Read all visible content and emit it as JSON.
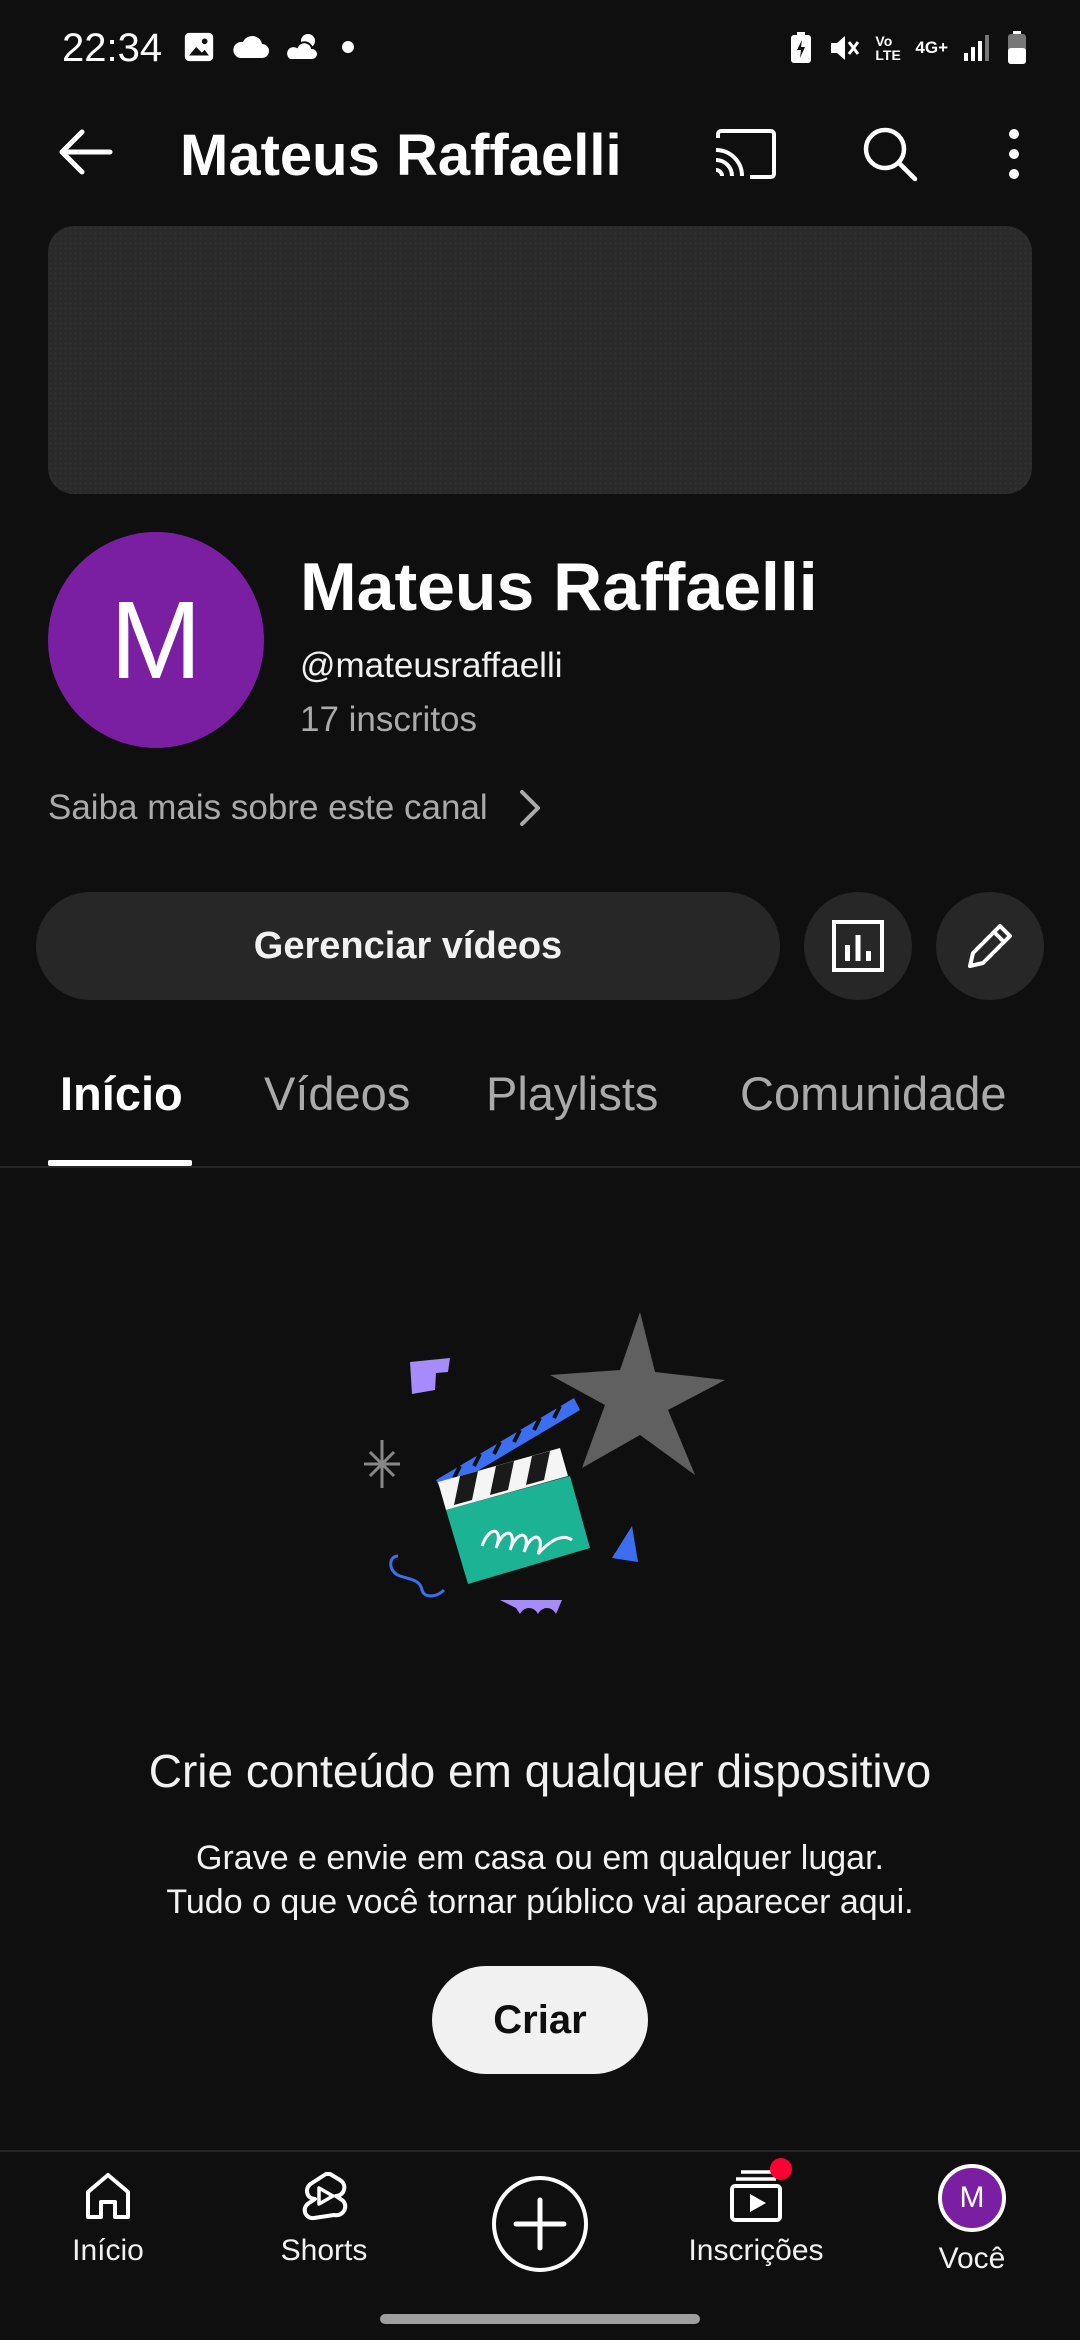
{
  "status_bar": {
    "time": "22:34",
    "left_icons": [
      "gallery-icon",
      "cloud-icon",
      "weather-icon",
      "dot-icon"
    ],
    "right_icons": [
      "battery-saver-icon",
      "mute-icon",
      "volte-icon",
      "network-4g-icon",
      "signal-icon",
      "battery-icon"
    ],
    "volte_label": "Vo LTE",
    "network_label": "4G+"
  },
  "app_bar": {
    "title": "Mateus Raffaelli",
    "icons": [
      "back-arrow-icon",
      "cast-icon",
      "search-icon",
      "more-vert-icon"
    ]
  },
  "channel": {
    "avatar_letter": "M",
    "avatar_color": "#7b1fa2",
    "name": "Mateus Raffaelli",
    "handle": "@mateusraffaelli",
    "subscribers": "17 inscritos",
    "more_info": "Saiba mais sobre este canal"
  },
  "actions": {
    "manage_label": "Gerenciar vídeos",
    "analytics_icon": "analytics-icon",
    "edit_icon": "edit-pencil-icon"
  },
  "tabs": [
    {
      "label": "Início",
      "active": true
    },
    {
      "label": "Vídeos",
      "active": false
    },
    {
      "label": "Playlists",
      "active": false
    },
    {
      "label": "Comunidade",
      "active": false
    }
  ],
  "empty_state": {
    "illustration": "clapperboard-illustration",
    "title": "Crie conteúdo em qualquer dispositivo",
    "line1": "Grave e envie em casa ou em qualquer lugar.",
    "line2": "Tudo o que você tornar público vai aparecer aqui.",
    "button": "Criar"
  },
  "bottom_nav": {
    "items": [
      {
        "label": "Início",
        "icon": "home-icon"
      },
      {
        "label": "Shorts",
        "icon": "shorts-icon"
      },
      {
        "label": "",
        "icon": "create-plus-icon"
      },
      {
        "label": "Inscrições",
        "icon": "subscriptions-icon"
      },
      {
        "label": "Você",
        "icon": "account-avatar-icon"
      }
    ],
    "avatar_letter": "M",
    "notification_color": "#ff0033"
  }
}
